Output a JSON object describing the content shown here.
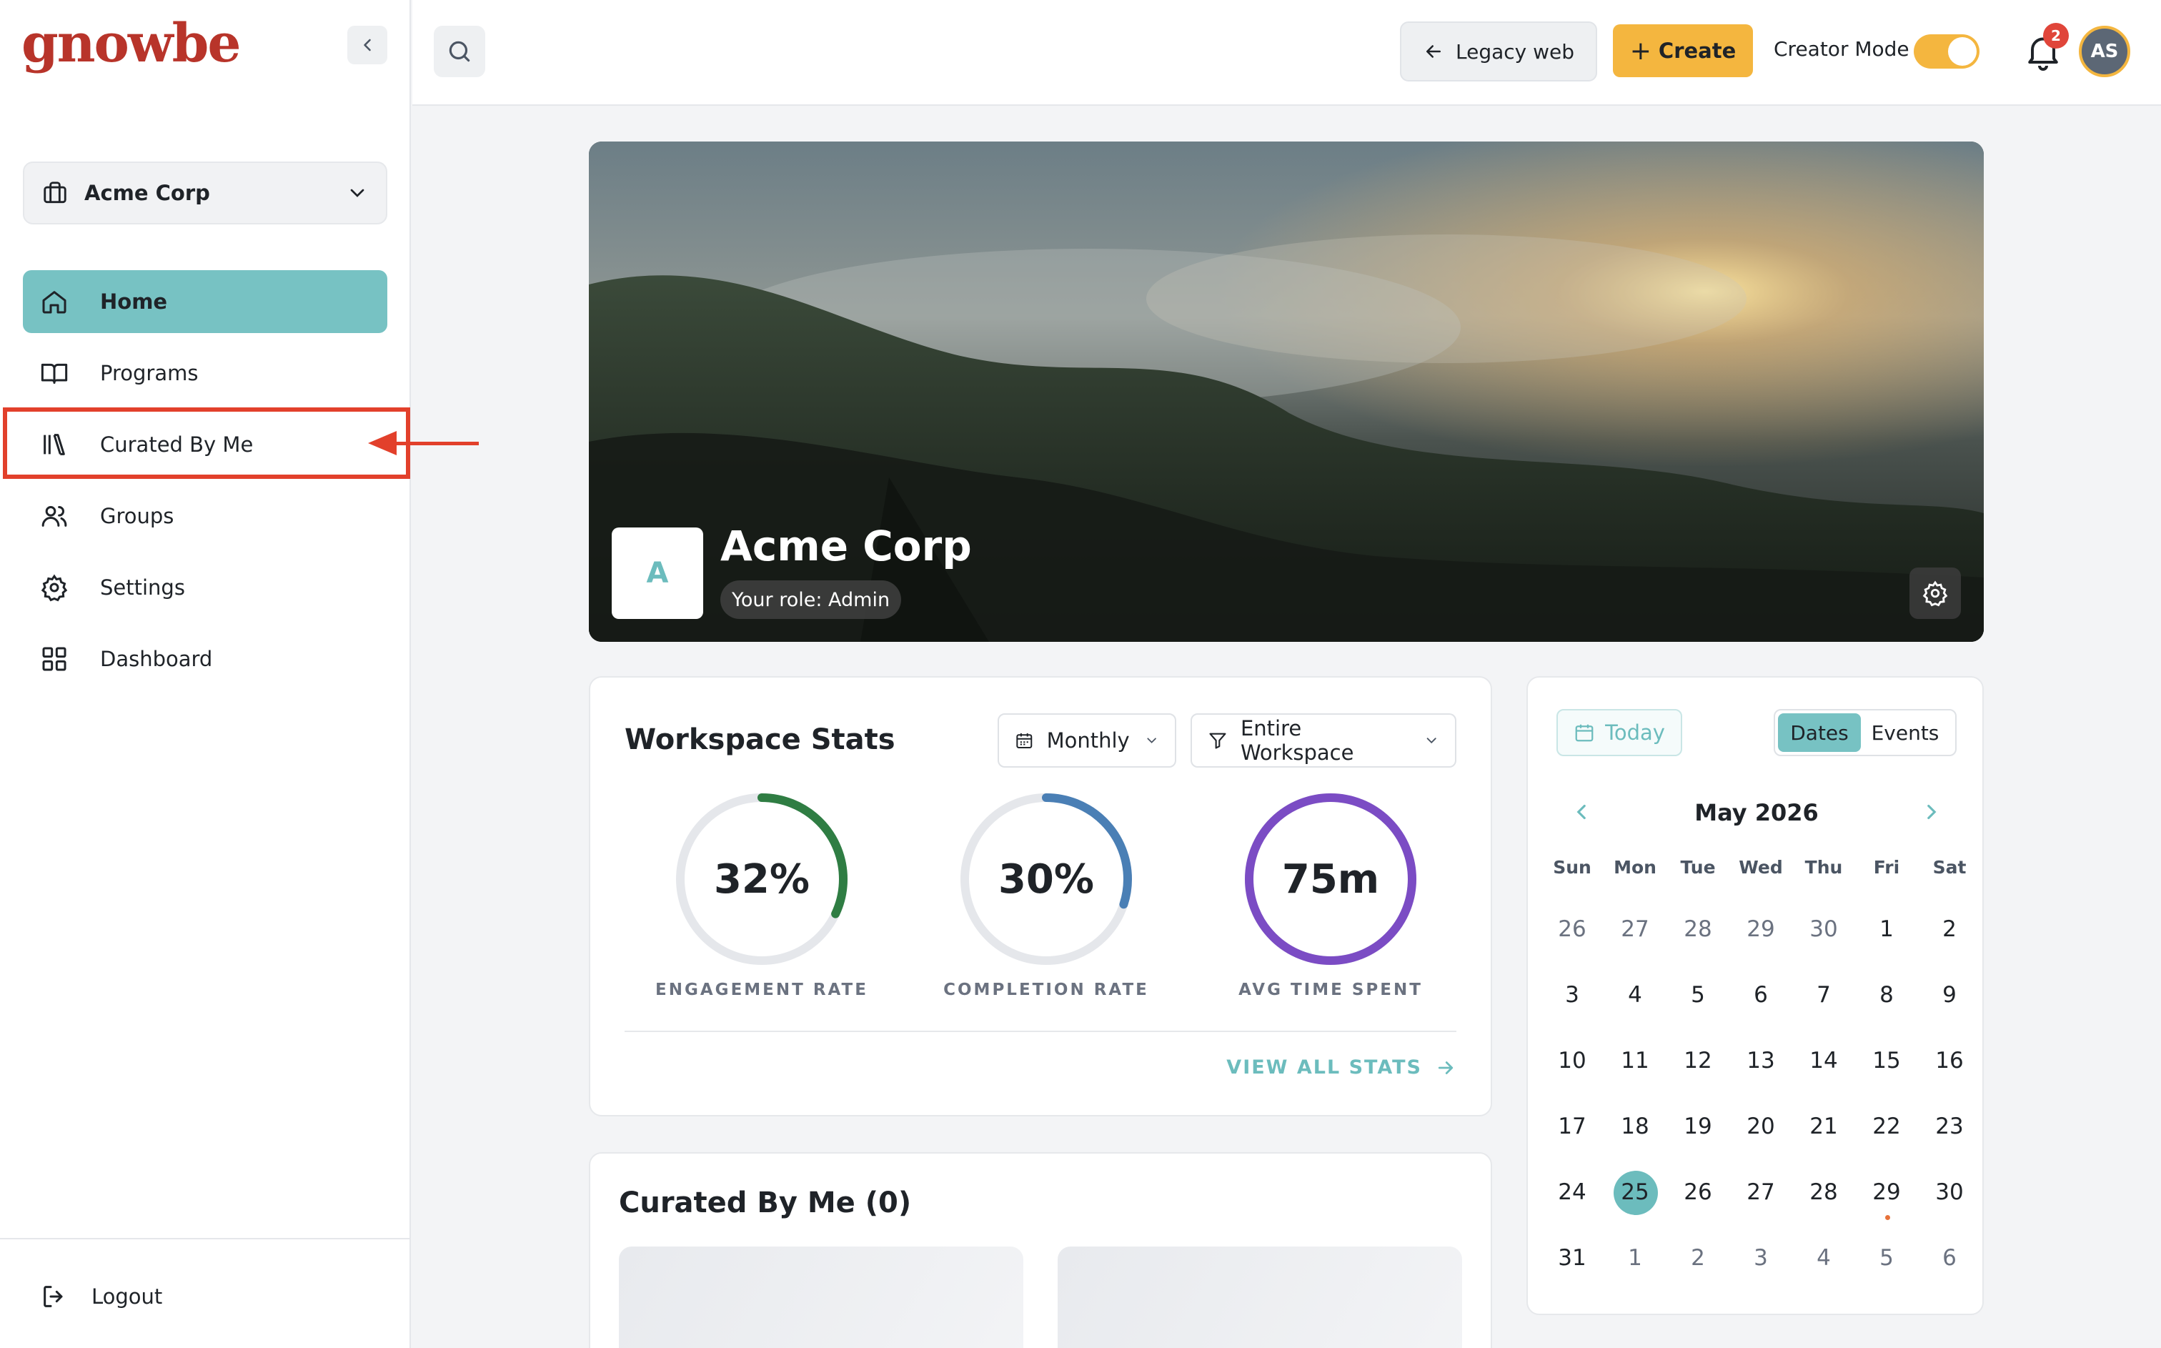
{
  "brand": {
    "logo_text": "gnowbe"
  },
  "sidebar": {
    "org": "Acme Corp",
    "items": [
      {
        "label": "Home",
        "active": true
      },
      {
        "label": "Programs"
      },
      {
        "label": "Curated By Me"
      },
      {
        "label": "Groups"
      },
      {
        "label": "Settings"
      },
      {
        "label": "Dashboard"
      }
    ],
    "logout": "Logout"
  },
  "header": {
    "legacy_label": "Legacy web",
    "create_label": "Create",
    "creator_mode_label": "Creator Mode",
    "creator_mode_on": true,
    "notification_count": "2",
    "avatar_initials": "AS"
  },
  "hero": {
    "avatar_letter": "A",
    "title": "Acme Corp",
    "role": "Your role: Admin"
  },
  "stats": {
    "title": "Workspace Stats",
    "period": "Monthly",
    "scope": "Entire Workspace",
    "metrics": [
      {
        "value": "32%",
        "label": "ENGAGEMENT RATE",
        "fraction": 0.32,
        "color": "#2f7d43"
      },
      {
        "value": "30%",
        "label": "COMPLETION RATE",
        "fraction": 0.3,
        "color": "#4a7fb5"
      },
      {
        "value": "75m",
        "label": "AVG TIME SPENT",
        "fraction": 1.0,
        "color": "#7b4cc4"
      }
    ],
    "view_all": "VIEW ALL STATS"
  },
  "curated": {
    "title": "Curated By Me (0)"
  },
  "calendar": {
    "today_label": "Today",
    "tabs": [
      "Dates",
      "Events"
    ],
    "month": "May 2026",
    "weekdays": [
      "Sun",
      "Mon",
      "Tue",
      "Wed",
      "Thu",
      "Fri",
      "Sat"
    ],
    "weeks": [
      [
        "26",
        "27",
        "28",
        "29",
        "30",
        "1",
        "2"
      ],
      [
        "3",
        "4",
        "5",
        "6",
        "7",
        "8",
        "9"
      ],
      [
        "10",
        "11",
        "12",
        "13",
        "14",
        "15",
        "16"
      ],
      [
        "17",
        "18",
        "19",
        "20",
        "21",
        "22",
        "23"
      ],
      [
        "24",
        "25",
        "26",
        "27",
        "28",
        "29",
        "30"
      ],
      [
        "31",
        "1",
        "2",
        "3",
        "4",
        "5",
        "6"
      ]
    ],
    "selected": "25",
    "event_day": "29"
  },
  "colors": {
    "accent": "#77c2c3",
    "brand": "#b8342a",
    "create": "#f4b63f",
    "annotation": "#e2402b"
  }
}
